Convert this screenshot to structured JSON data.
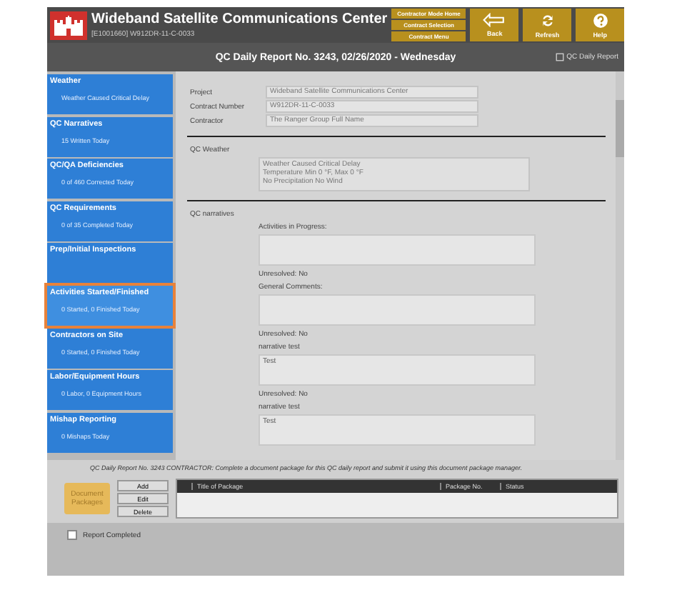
{
  "header": {
    "title": "Wideband Satellite Communications Center",
    "subtitle": "[E1001660] W912DR-11-C-0033",
    "nav_links": [
      "Contractor Mode Home",
      "Contract Selection",
      "Contract Menu"
    ],
    "buttons": [
      {
        "kind": "back",
        "label": "Back"
      },
      {
        "kind": "refresh",
        "label": "Refresh"
      },
      {
        "kind": "help",
        "label": "Help"
      }
    ]
  },
  "report_bar": {
    "title": "QC Daily Report No. 3243, 02/26/2020 - Wednesday",
    "link": "QC Daily Report"
  },
  "sidebar": {
    "items": [
      {
        "title": "Weather",
        "summary": "Weather Caused Critical Delay",
        "highlighted": false
      },
      {
        "title": "QC Narratives",
        "summary": "15 Written Today",
        "highlighted": false
      },
      {
        "title": "QC/QA Deficiencies",
        "summary": "0 of 460 Corrected Today",
        "highlighted": false
      },
      {
        "title": "QC Requirements",
        "summary": "0 of 35 Completed Today",
        "highlighted": false
      },
      {
        "title": "Prep/Initial Inspections",
        "highlighted": false
      },
      {
        "title": "Activities Started/Finished",
        "summary": "0 Started, 0 Finished Today",
        "highlighted": true
      },
      {
        "title": "Contractors on Site",
        "summary": "0 Started, 0 Finished Today",
        "highlighted": false
      },
      {
        "title": "Labor/Equipment Hours",
        "summary": "0 Labor, 0 Equipment Hours",
        "highlighted": false
      },
      {
        "title": "Mishap Reporting",
        "summary": "0 Mishaps Today",
        "highlighted": false
      }
    ]
  },
  "form": {
    "fields": [
      {
        "label": "Project",
        "value": "Wideband Satellite Communications Center"
      },
      {
        "label": "Contract Number",
        "value": "W912DR-11-C-0033"
      },
      {
        "label": "Contractor",
        "value": "The Ranger Group Full Name"
      }
    ],
    "weather": {
      "label": "QC Weather",
      "lines": [
        "Weather Caused Critical Delay",
        "Temperature Min 0 °F, Max 0 °F",
        "No Precipitation  No Wind"
      ]
    },
    "narratives": {
      "label": "QC narratives",
      "entries": [
        {
          "heading": "Activities in Progress:",
          "status": "Unresolved: No"
        },
        {
          "heading": "General Comments:",
          "status": "Unresolved: No"
        },
        {
          "heading": "narrative test",
          "text": "Test",
          "status": "Unresolved: No"
        },
        {
          "heading": "narrative test",
          "text": "Test"
        }
      ]
    }
  },
  "packages": {
    "message": "QC Daily Report No. 3243  CONTRACTOR: Complete a document package for this QC daily report and submit it using this document package manager.",
    "folder_label": "Document Packages",
    "buttons": [
      "Add",
      "Edit",
      "Delete"
    ],
    "columns": [
      "Title of Package",
      "Package No.",
      "Status"
    ]
  },
  "report_completed": {
    "label": "Report Completed",
    "checked": false
  }
}
